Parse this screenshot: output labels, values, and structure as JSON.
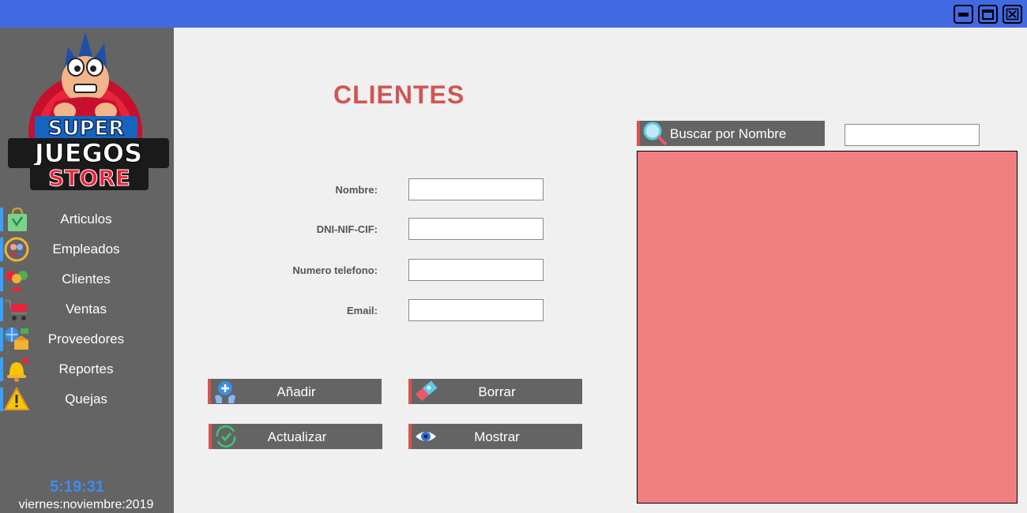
{
  "window": {
    "title_bar_color": "#4169e1",
    "controls": [
      "minimize-icon",
      "maximize-icon",
      "close-icon"
    ]
  },
  "sidebar": {
    "background": "#646464",
    "logo_text": [
      "SUPER",
      "JUEGOS",
      "STORE"
    ],
    "items": [
      {
        "label": "Articulos",
        "icon": "shopping-bag-icon"
      },
      {
        "label": "Empleados",
        "icon": "employees-icon"
      },
      {
        "label": "Clientes",
        "icon": "clients-icon"
      },
      {
        "label": "Ventas",
        "icon": "shopping-cart-icon"
      },
      {
        "label": "Proveedores",
        "icon": "suppliers-icon"
      },
      {
        "label": "Reportes",
        "icon": "bell-icon"
      },
      {
        "label": "Quejas",
        "icon": "warning-icon"
      }
    ],
    "clock": "5:19:31",
    "date": "viernes:noviembre:2019"
  },
  "main": {
    "title": "CLIENTES",
    "form": {
      "nombre_label": "Nombre:",
      "dni_label": "DNI-NIF-CIF:",
      "telefono_label": "Numero telefono:",
      "email_label": "Email:",
      "nombre_value": "",
      "dni_value": "",
      "telefono_value": "",
      "email_value": ""
    },
    "buttons": {
      "add": "Añadir",
      "delete": "Borrar",
      "update": "Actualizar",
      "show": "Mostrar"
    },
    "search": {
      "button_label": "Buscar por Nombre",
      "value": ""
    },
    "results_panel_color": "#f08080"
  }
}
